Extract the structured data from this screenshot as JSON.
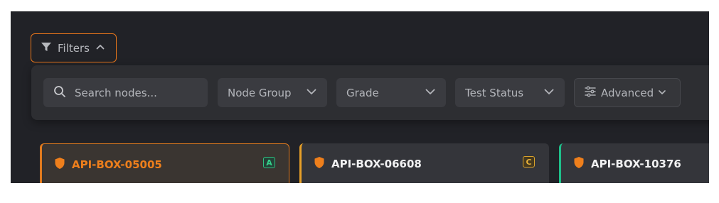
{
  "filters": {
    "label": "Filters"
  },
  "search": {
    "placeholder": "Search nodes..."
  },
  "dropdowns": [
    {
      "label": "Node Group"
    },
    {
      "label": "Grade"
    },
    {
      "label": "Test Status"
    }
  ],
  "advanced": {
    "label": "Advanced"
  },
  "cards": [
    {
      "title": "API-BOX-05005",
      "grade": "A",
      "accent": "#e07a1e"
    },
    {
      "title": "API-BOX-06608",
      "grade": "C",
      "accent": "#e8a028"
    },
    {
      "title": "API-BOX-10376",
      "accent": "#1fbf8a"
    }
  ],
  "colors": {
    "background": "#212227",
    "panel": "#2d2e32",
    "accent_orange": "#e8761b",
    "grade_a": "#36d08a",
    "grade_c": "#e8b13a"
  }
}
